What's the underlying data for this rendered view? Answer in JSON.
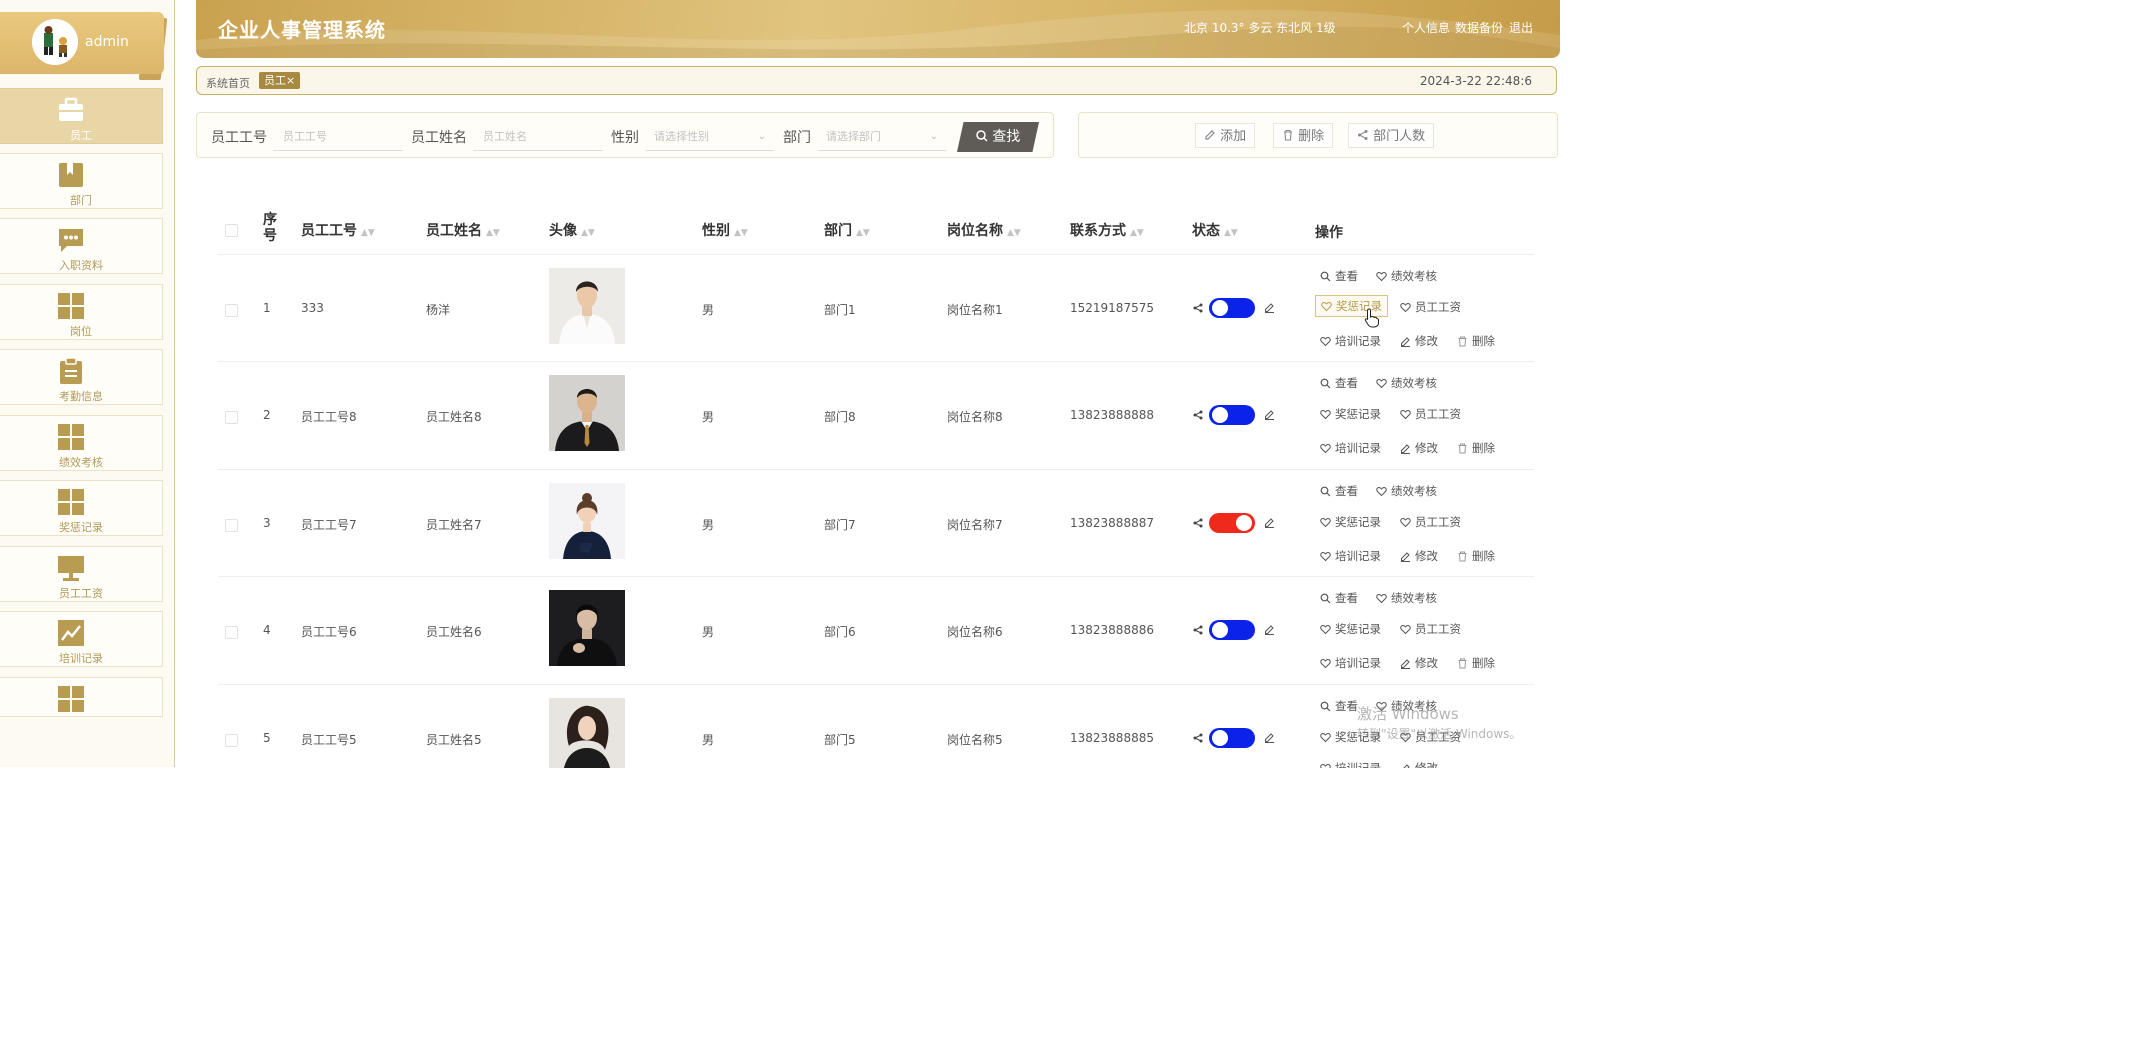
{
  "user": {
    "name": "admin"
  },
  "sidebar": {
    "items": [
      {
        "label": "员工",
        "icon": "briefcase-icon",
        "active": true
      },
      {
        "label": "部门",
        "icon": "folder-icon"
      },
      {
        "label": "入职资料",
        "icon": "chat-icon"
      },
      {
        "label": "岗位",
        "icon": "grid-icon"
      },
      {
        "label": "考勤信息",
        "icon": "clipboard-icon"
      },
      {
        "label": "绩效考核",
        "icon": "grid-icon"
      },
      {
        "label": "奖惩记录",
        "icon": "grid-icon"
      },
      {
        "label": "员工工资",
        "icon": "monitor-icon"
      },
      {
        "label": "培训记录",
        "icon": "chart-icon"
      },
      {
        "label": "",
        "icon": "grid-icon"
      }
    ]
  },
  "header": {
    "title": "企业人事管理系统",
    "weather": "北京  10.3°  多云  东北风  1级",
    "links": [
      "个人信息",
      "数据备份",
      "退出"
    ]
  },
  "breadcrumb": {
    "home": "系统首页",
    "tag": "员工×",
    "datetime": "2024-3-22 22:48:6"
  },
  "search": {
    "emp_no_label": "员工工号",
    "emp_no_placeholder": "员工工号",
    "emp_name_label": "员工姓名",
    "emp_name_placeholder": "员工姓名",
    "gender_label": "性别",
    "gender_placeholder": "请选择性别",
    "dept_label": "部门",
    "dept_placeholder": "请选择部门",
    "button": "查找"
  },
  "actions": {
    "add": "添加",
    "delete": "删除",
    "dept_count": "部门人数"
  },
  "table": {
    "headers": {
      "index": "序号",
      "emp_no": "员工工号",
      "emp_name": "员工姓名",
      "avatar": "头像",
      "gender": "性别",
      "dept": "部门",
      "post": "岗位名称",
      "phone": "联系方式",
      "status": "状态",
      "ops": "操作"
    },
    "rows": [
      {
        "index": "1",
        "emp_no": "333",
        "emp_name": "杨洋",
        "gender": "男",
        "dept": "部门1",
        "post": "岗位名称1",
        "phone": "15219187575",
        "status_on": true
      },
      {
        "index": "2",
        "emp_no": "员工工号8",
        "emp_name": "员工姓名8",
        "gender": "男",
        "dept": "部门8",
        "post": "岗位名称8",
        "phone": "13823888888",
        "status_on": true
      },
      {
        "index": "3",
        "emp_no": "员工工号7",
        "emp_name": "员工姓名7",
        "gender": "男",
        "dept": "部门7",
        "post": "岗位名称7",
        "phone": "13823888887",
        "status_on": false
      },
      {
        "index": "4",
        "emp_no": "员工工号6",
        "emp_name": "员工姓名6",
        "gender": "男",
        "dept": "部门6",
        "post": "岗位名称6",
        "phone": "13823888886",
        "status_on": true
      },
      {
        "index": "5",
        "emp_no": "员工工号5",
        "emp_name": "员工姓名5",
        "gender": "男",
        "dept": "部门5",
        "post": "岗位名称5",
        "phone": "13823888885",
        "status_on": true
      }
    ],
    "ops": {
      "view": "查看",
      "performance": "绩效考核",
      "reward": "奖惩记录",
      "salary": "员工工资",
      "training": "培训记录",
      "edit": "修改",
      "delete": "删除"
    }
  },
  "watermark": {
    "line1": "激活 Windows",
    "line2": "转到\"设置\"以激活 Windows。"
  },
  "colors": {
    "accent": "#c9a24f",
    "toggle_on": "#0b22e8",
    "toggle_off": "#f02a1a",
    "search_button": "#5f5c57"
  }
}
